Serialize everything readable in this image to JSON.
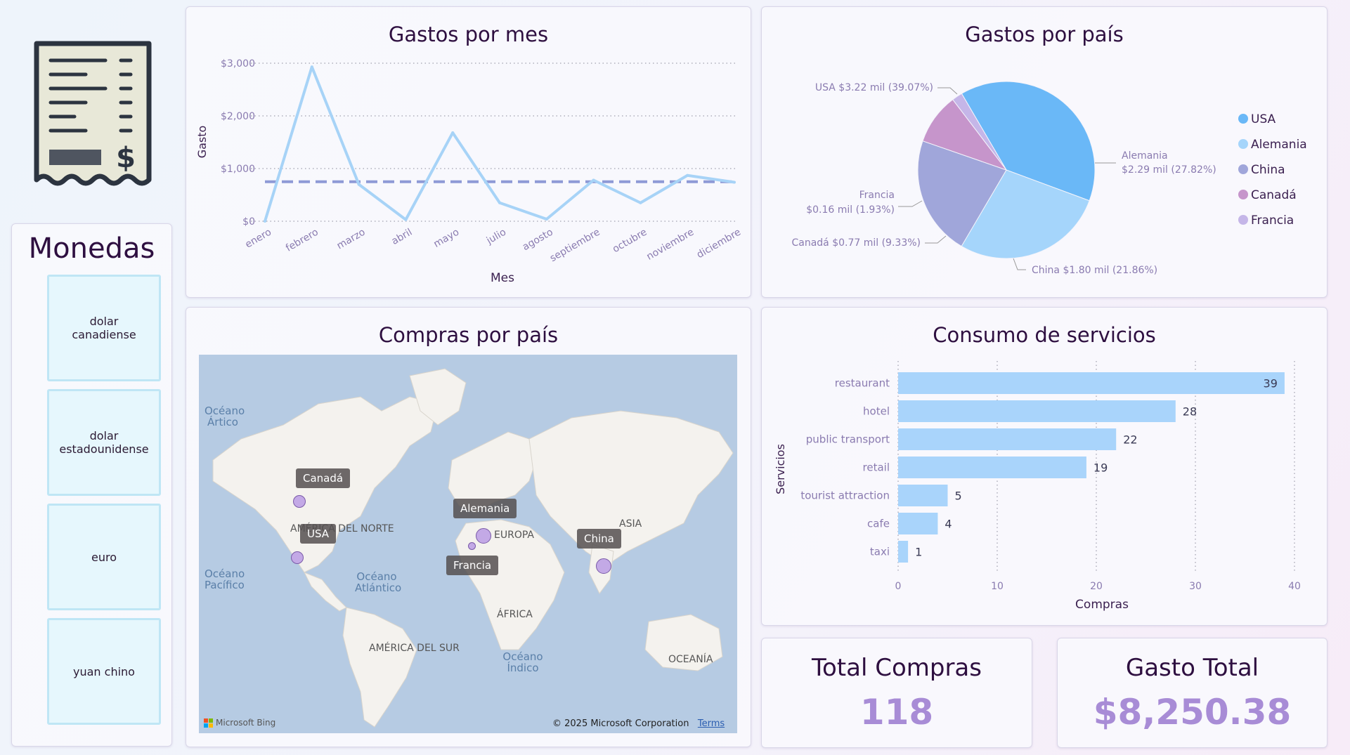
{
  "sidebar": {
    "title": "Monedas",
    "currencies": [
      "dolar canadiense",
      "dolar estadounidense",
      "euro",
      "yuan chino"
    ]
  },
  "line_card": {
    "title": "Gastos por mes",
    "chart_data": {
      "type": "line",
      "categories": [
        "enero",
        "febrero",
        "marzo",
        "abril",
        "mayo",
        "julio",
        "agosto",
        "septiembre",
        "octubre",
        "noviembre",
        "diciembre"
      ],
      "values": [
        0,
        2930,
        700,
        30,
        1680,
        350,
        40,
        780,
        350,
        870,
        740
      ],
      "average_line": 750,
      "xlabel": "Mes",
      "ylabel": "Gasto",
      "ylim": [
        0,
        3000
      ],
      "yticks": [
        0,
        1000,
        2000,
        3000
      ],
      "ytick_labels": [
        "$0",
        "$1,000",
        "$2,000",
        "$3,000"
      ],
      "grid": true,
      "color": "#a7d3f7",
      "avg_color": "#8e9ad6"
    }
  },
  "pie_card": {
    "title": "Gastos por país",
    "chart_data": {
      "type": "pie",
      "labels": [
        "USA",
        "Alemania",
        "China",
        "Canadá",
        "Francia"
      ],
      "values": [
        39.07,
        27.82,
        21.86,
        9.33,
        1.93
      ],
      "amounts": [
        "$3.22 mil",
        "$2.29 mil",
        "$1.80 mil",
        "$0.77 mil",
        "$0.16 mil"
      ],
      "data_labels": [
        "USA $3.22 mil (39.07%)",
        "Alemania",
        "$2.29 mil (27.82%)",
        "China $1.80 mil (21.86%)",
        "Canadá $0.77 mil (9.33%)",
        "Francia",
        "$0.16 mil (1.93%)"
      ],
      "colors": [
        "#6ab8f7",
        "#a5d5fb",
        "#a0a6da",
        "#c695cb",
        "#c5b6e8"
      ],
      "legend_position": "right"
    }
  },
  "map_card": {
    "title": "Compras por país",
    "ocean_labels": [
      "Océano Ártico",
      "Océano Pacífico",
      "Océano Atlántico",
      "Océano Índico"
    ],
    "continent_labels": [
      "AMÉRICA DEL NORTE",
      "EUROPA",
      "ASIA",
      "ÁFRICA",
      "AMÉRICA DEL SUR",
      "OCEANÍA"
    ],
    "markers": [
      "Canadá",
      "USA",
      "Alemania",
      "Francia",
      "China"
    ],
    "bing_label": "Microsoft Bing",
    "copyright": "© 2025 Microsoft Corporation",
    "terms": "Terms"
  },
  "bar_card": {
    "title": "Consumo de servicios",
    "chart_data": {
      "type": "bar",
      "orientation": "horizontal",
      "categories": [
        "restaurant",
        "hotel",
        "public transport",
        "retail",
        "tourist attraction",
        "cafe",
        "taxi"
      ],
      "values": [
        39,
        28,
        22,
        19,
        5,
        4,
        1
      ],
      "xlabel": "Compras",
      "ylabel": "Servicios",
      "xlim": [
        0,
        40
      ],
      "xticks": [
        0,
        10,
        20,
        30,
        40
      ],
      "grid": true,
      "color": "#a9d4fb"
    }
  },
  "kpi": {
    "total_compras_label": "Total Compras",
    "total_compras_value": "118",
    "gasto_total_label": "Gasto Total",
    "gasto_total_value": "$8,250.38"
  },
  "colors": {
    "title": "#2e0f40",
    "label": "#8a7bb0",
    "kpi": "#a88cd6"
  }
}
